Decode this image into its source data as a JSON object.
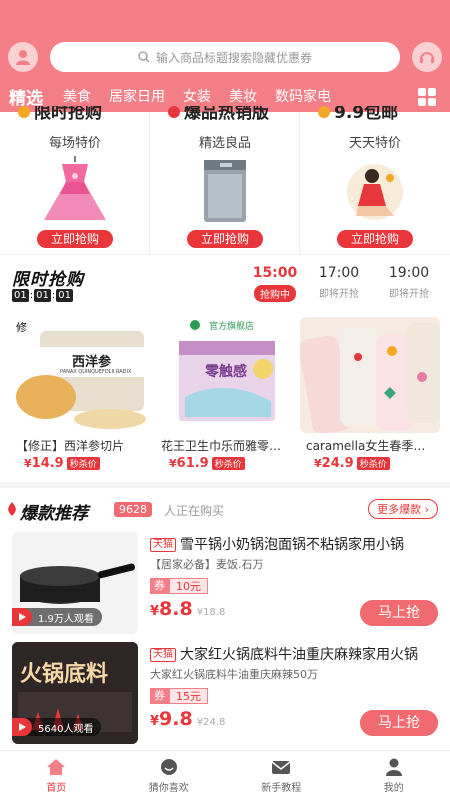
{
  "search": {
    "placeholder": "输入商品标题搜索隐藏优惠券"
  },
  "categories": [
    "精选",
    "美食",
    "居家日用",
    "女装",
    "美妆",
    "数码家电"
  ],
  "promos": [
    {
      "title": "限时抢购",
      "subtitle": "每场特价",
      "button": "立即抢购"
    },
    {
      "title": "爆品热销版",
      "subtitle": "精选良品",
      "button": "立即抢购"
    },
    {
      "title": "9.9包邮",
      "subtitle": "天天特价",
      "button": "立即抢购"
    }
  ],
  "flash": {
    "title": "限时抢购",
    "countdown": [
      "01",
      "01",
      "01"
    ],
    "slots": [
      {
        "time": "15:00",
        "state": "抢购中"
      },
      {
        "time": "17:00",
        "state": "即将开抢"
      },
      {
        "time": "19:00",
        "state": "即将开抢"
      }
    ],
    "products": [
      {
        "name": "【修正】西洋参切片",
        "currency": "¥",
        "price": "14.9",
        "tag": "秒杀价",
        "img_label": "西洋参",
        "img_sub": "PANAX QUINQUEFOLII RADIX"
      },
      {
        "name": "花王卫生巾乐而雅零触感",
        "currency": "¥",
        "price": "61.9",
        "tag": "秒杀价",
        "img_label": "零触感",
        "img_sub": "官方旗舰店"
      },
      {
        "name": "caramella女生春季袜子",
        "currency": "¥",
        "price": "24.9",
        "tag": "秒杀价"
      }
    ]
  },
  "hot": {
    "title": "爆款推荐",
    "count": "9628",
    "live_text": "人正在购买",
    "more": "更多爆款",
    "items": [
      {
        "platform": "天猫",
        "title": "雪平锅小奶锅泡面锅不粘锅家用小锅",
        "desc": "【居家必备】麦饭.石万",
        "coupon_label": "券",
        "coupon_value": "10元",
        "currency": "¥",
        "price": "8.8",
        "orig": "¥18.8",
        "button": "马上抢",
        "watch": "1.9万人观看"
      },
      {
        "platform": "天猫",
        "title": "大家红火锅底料牛油重庆麻辣家用火锅",
        "desc": "大家红火锅底料牛油重庆麻辣50万",
        "coupon_label": "券",
        "coupon_value": "15元",
        "currency": "¥",
        "price": "9.8",
        "orig": "¥24.8",
        "button": "马上抢",
        "watch": "5640人观看",
        "img_label": "火锅底料"
      }
    ]
  },
  "tabs": [
    {
      "label": "首页",
      "icon": "home-icon"
    },
    {
      "label": "猜你喜欢",
      "icon": "smile-icon"
    },
    {
      "label": "新手教程",
      "icon": "mail-icon"
    },
    {
      "label": "我的",
      "icon": "user-icon"
    }
  ],
  "colors": {
    "brand": "#f57f86",
    "accent": "#e8363b"
  }
}
